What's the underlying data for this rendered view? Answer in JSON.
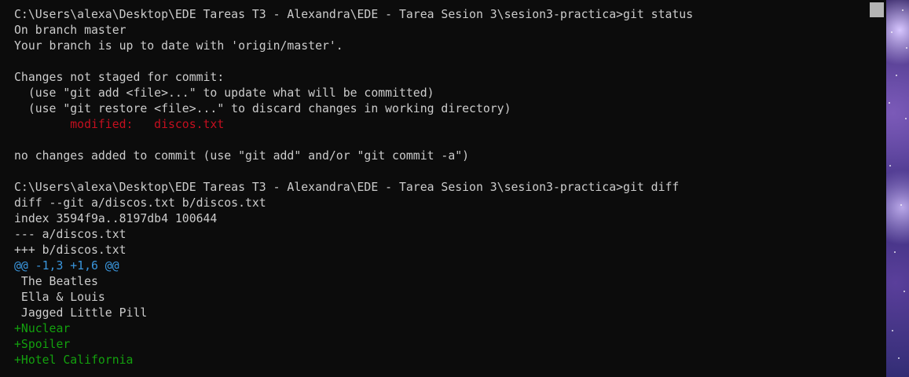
{
  "terminal": {
    "lines": [
      {
        "text": "C:\\Users\\alexa\\Desktop\\EDE Tareas T3 - Alexandra\\EDE - Tarea Sesion 3\\sesion3-practica>git status",
        "color": "default"
      },
      {
        "text": "On branch master",
        "color": "default"
      },
      {
        "text": "Your branch is up to date with 'origin/master'.",
        "color": "default"
      },
      {
        "text": "",
        "color": "default"
      },
      {
        "text": "Changes not staged for commit:",
        "color": "default"
      },
      {
        "text": "  (use \"git add <file>...\" to update what will be committed)",
        "color": "default"
      },
      {
        "text": "  (use \"git restore <file>...\" to discard changes in working directory)",
        "color": "default"
      },
      {
        "text": "        modified:   discos.txt",
        "color": "red"
      },
      {
        "text": "",
        "color": "default"
      },
      {
        "text": "no changes added to commit (use \"git add\" and/or \"git commit -a\")",
        "color": "default"
      },
      {
        "text": "",
        "color": "default"
      },
      {
        "text": "C:\\Users\\alexa\\Desktop\\EDE Tareas T3 - Alexandra\\EDE - Tarea Sesion 3\\sesion3-practica>git diff",
        "color": "default"
      },
      {
        "text": "diff --git a/discos.txt b/discos.txt",
        "color": "default"
      },
      {
        "text": "index 3594f9a..8197db4 100644",
        "color": "default"
      },
      {
        "text": "--- a/discos.txt",
        "color": "default"
      },
      {
        "text": "+++ b/discos.txt",
        "color": "default"
      },
      {
        "text": "@@ -1,3 +1,6 @@",
        "color": "cyan"
      },
      {
        "text": " The Beatles",
        "color": "default"
      },
      {
        "text": " Ella & Louis",
        "color": "default"
      },
      {
        "text": " Jagged Little Pill",
        "color": "default"
      },
      {
        "text": "+Nuclear",
        "color": "green"
      },
      {
        "text": "+Spoiler",
        "color": "green"
      },
      {
        "text": "+Hotel California",
        "color": "green"
      }
    ]
  },
  "colors": {
    "background": "#0c0c0c",
    "foreground": "#cccccc",
    "red": "#c50f1f",
    "cyan": "#3a96dd",
    "green": "#13a10e",
    "scrollbar_thumb": "#b4b4b4"
  },
  "scrollbar": {
    "position": 0.0
  }
}
